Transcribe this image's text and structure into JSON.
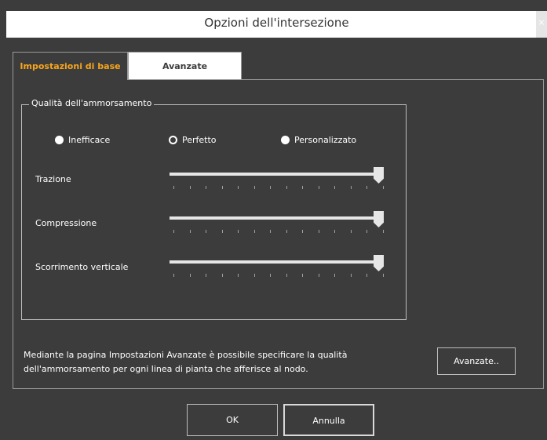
{
  "window": {
    "title": "Opzioni dell'intersezione",
    "close_glyph": "×"
  },
  "tabs": [
    {
      "label": "Impostazioni di base",
      "active": true,
      "color": "#f7a51c"
    },
    {
      "label": "Avanzate",
      "active": false
    }
  ],
  "group": {
    "legend": "Qualità dell'ammorsamento",
    "radios": [
      {
        "label": "Inefficace",
        "selected": false
      },
      {
        "label": "Perfetto",
        "selected": true
      },
      {
        "label": "Personalizzato",
        "selected": false
      }
    ],
    "sliders": [
      {
        "label": "Trazione",
        "value": 1.0
      },
      {
        "label": "Compressione",
        "value": 1.0
      },
      {
        "label": "Scorrimento verticale",
        "value": 1.0
      }
    ]
  },
  "description": "Mediante la pagina Impostazioni Avanzate è possibile specificare  la qualità dell'ammorsamento per ogni linea di pianta che afferisce al nodo.",
  "buttons": {
    "advanced": "Avanzate..",
    "ok": "OK",
    "cancel": "Annulla"
  },
  "colors": {
    "background": "#3c3c3c",
    "accent": "#f7a51c",
    "text": "#ffffff"
  }
}
